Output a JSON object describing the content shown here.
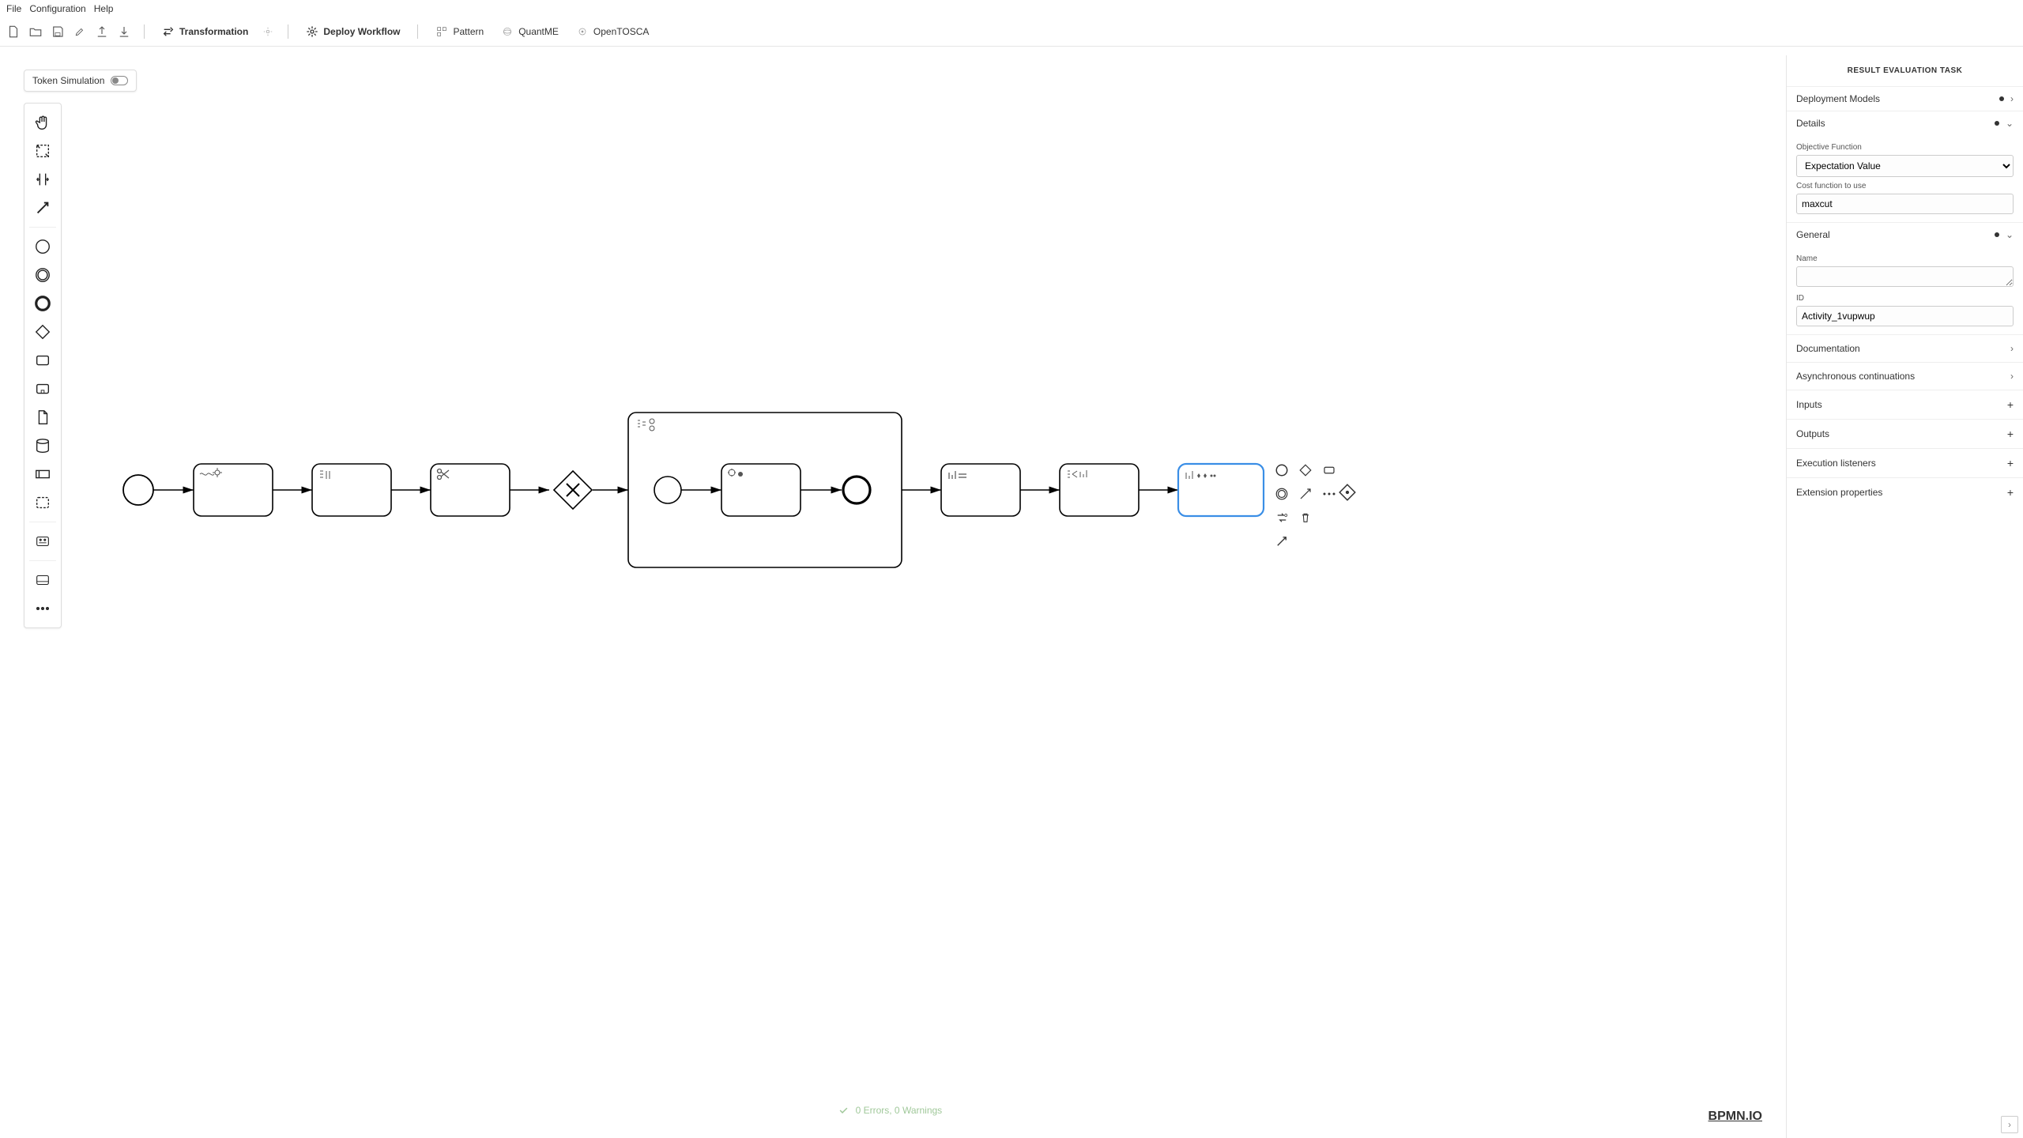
{
  "menubar": {
    "file": "File",
    "config": "Configuration",
    "help": "Help"
  },
  "toolbar": {
    "transformation": "Transformation",
    "deploy_workflow": "Deploy Workflow",
    "pattern": "Pattern",
    "quantme": "QuantME",
    "opentosca": "OpenTOSCA"
  },
  "token_simulation_label": "Token Simulation",
  "panel": {
    "title": "RESULT EVALUATION TASK",
    "deployment_models": "Deployment Models",
    "details": "Details",
    "objective_function_label": "Objective Function",
    "objective_function_value": "Expectation Value",
    "cost_function_label": "Cost function to use",
    "cost_function_value": "maxcut",
    "general": "General",
    "name_label": "Name",
    "name_value": "",
    "id_label": "ID",
    "id_value": "Activity_1vupwup",
    "documentation": "Documentation",
    "async": "Asynchronous continuations",
    "inputs": "Inputs",
    "outputs": "Outputs",
    "execution_listeners": "Execution listeners",
    "extension_properties": "Extension properties"
  },
  "status": "0 Errors, 0 Warnings",
  "logo": "BPMN.IO"
}
